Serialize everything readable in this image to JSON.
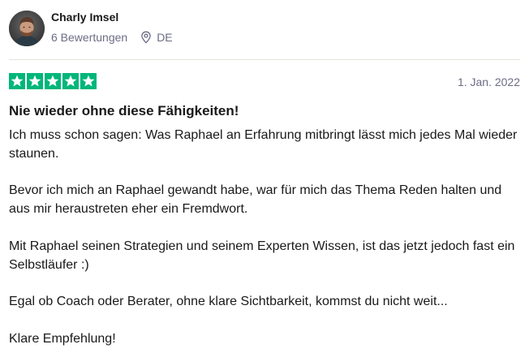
{
  "review": {
    "author": {
      "name": "Charly Imsel",
      "review_count": "6 Bewertungen",
      "country": "DE",
      "avatar_icon": "avatar-photo",
      "location_icon": "location-pin-icon"
    },
    "rating": {
      "stars": 5,
      "max": 5,
      "color": "#00b67a",
      "icon": "star-icon"
    },
    "date": "1. Jan. 2022",
    "title": "Nie wieder ohne diese Fähigkeiten!",
    "paragraphs": [
      "Ich muss schon sagen: Was Raphael an Erfahrung mitbringt lässt mich jedes Mal wieder staunen.",
      "Bevor ich mich an Raphael gewandt habe, war für mich das Thema Reden halten und aus mir heraustreten eher ein Fremdwort.",
      "Mit Raphael seinen Strategien und seinem Experten Wissen, ist das jetzt jedoch fast ein Selbstläufer :)",
      "Egal ob Coach oder Berater, ohne klare Sichtbarkeit, kommst du nicht weit...",
      "Klare Empfehlung!"
    ]
  }
}
